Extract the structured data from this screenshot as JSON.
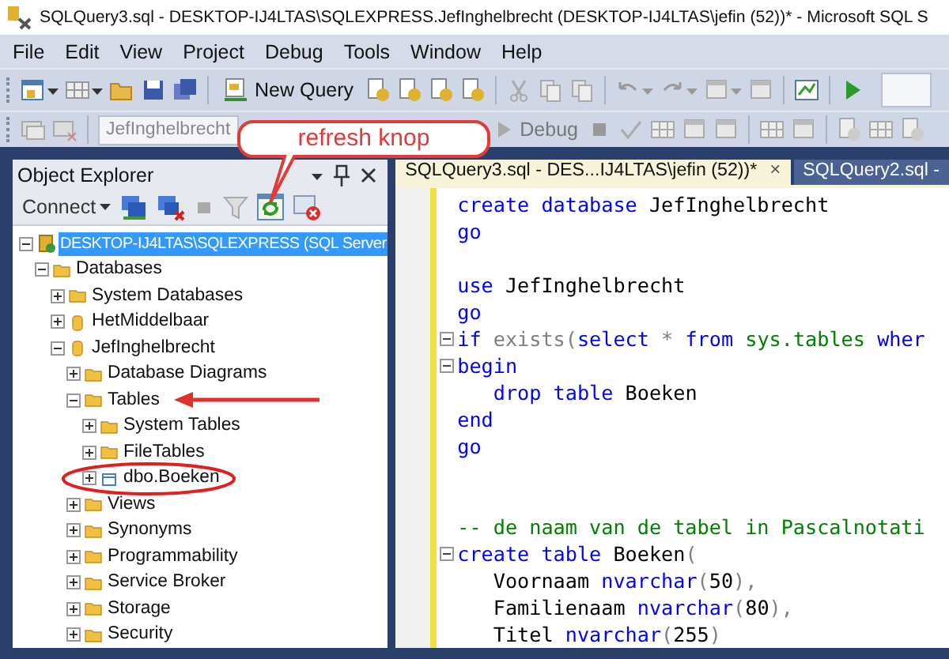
{
  "window": {
    "title": "SQLQuery3.sql - DESKTOP-IJ4LTAS\\SQLEXPRESS.JefInghelbrecht (DESKTOP-IJ4LTAS\\jefin (52))* - Microsoft SQL S"
  },
  "menu": [
    "File",
    "Edit",
    "View",
    "Project",
    "Debug",
    "Tools",
    "Window",
    "Help"
  ],
  "toolbar": {
    "new_query": "New Query",
    "database": "JefInghelbrecht",
    "debug": "Debug"
  },
  "callout": {
    "text": "refresh knop"
  },
  "object_explorer": {
    "title": "Object Explorer",
    "connect": "Connect",
    "tree": [
      {
        "label": "DESKTOP-IJ4LTAS\\SQLEXPRESS (SQL Server",
        "kind": "server",
        "expanded": true,
        "selected": true,
        "children": [
          {
            "label": "Databases",
            "kind": "folder",
            "expanded": true,
            "selected": false,
            "children": [
              {
                "label": "System Databases",
                "kind": "folder",
                "expanded": false,
                "selected": false
              },
              {
                "label": "HetMiddelbaar",
                "kind": "database",
                "expanded": false,
                "selected": false
              },
              {
                "label": "JefInghelbrecht",
                "kind": "database",
                "expanded": true,
                "selected": false,
                "children": [
                  {
                    "label": "Database Diagrams",
                    "kind": "folder",
                    "expanded": false,
                    "selected": false
                  },
                  {
                    "label": "Tables",
                    "kind": "folder",
                    "expanded": true,
                    "selected": false,
                    "pointed": true,
                    "children": [
                      {
                        "label": "System Tables",
                        "kind": "folder",
                        "expanded": false,
                        "selected": false
                      },
                      {
                        "label": "FileTables",
                        "kind": "folder",
                        "expanded": false,
                        "selected": false
                      },
                      {
                        "label": "dbo.Boeken",
                        "kind": "table",
                        "expanded": false,
                        "selected": false,
                        "circled": true
                      }
                    ]
                  },
                  {
                    "label": "Views",
                    "kind": "folder",
                    "expanded": false,
                    "selected": false
                  },
                  {
                    "label": "Synonyms",
                    "kind": "folder",
                    "expanded": false,
                    "selected": false
                  },
                  {
                    "label": "Programmability",
                    "kind": "folder",
                    "expanded": false,
                    "selected": false
                  },
                  {
                    "label": "Service Broker",
                    "kind": "folder",
                    "expanded": false,
                    "selected": false
                  },
                  {
                    "label": "Storage",
                    "kind": "folder",
                    "expanded": false,
                    "selected": false
                  },
                  {
                    "label": "Security",
                    "kind": "folder",
                    "expanded": false,
                    "selected": false
                  }
                ]
              }
            ]
          }
        ]
      }
    ]
  },
  "tabs": [
    {
      "label": "SQLQuery3.sql - DES...IJ4LTAS\\jefin (52))*",
      "selected": true,
      "close": "×"
    },
    {
      "label": "SQLQuery2.sql -",
      "selected": false
    }
  ],
  "editor": {
    "lines": [
      {
        "tokens": [
          {
            "text": "create database",
            "kind": "keyword"
          },
          {
            "text": " JefInghelbrecht",
            "kind": "identifier"
          }
        ]
      },
      {
        "tokens": [
          {
            "text": "go",
            "kind": "keyword"
          }
        ]
      },
      {
        "kind": "blank"
      },
      {
        "tokens": [
          {
            "text": "use",
            "kind": "keyword"
          },
          {
            "text": " JefInghelbrecht",
            "kind": "identifier"
          }
        ]
      },
      {
        "tokens": [
          {
            "text": "go",
            "kind": "keyword"
          }
        ]
      },
      {
        "fold": true,
        "tokens": [
          {
            "text": "if",
            "kind": "keyword"
          },
          {
            "text": " exists(",
            "kind": "function"
          },
          {
            "text": "select",
            "kind": "keyword"
          },
          {
            "text": " * ",
            "kind": "operator"
          },
          {
            "text": "from",
            "kind": "keyword"
          },
          {
            "text": " sys.tables ",
            "kind": "system"
          },
          {
            "text": "wher",
            "kind": "keyword"
          }
        ]
      },
      {
        "fold": true,
        "tokens": [
          {
            "text": "begin",
            "kind": "keyword"
          }
        ]
      },
      {
        "tokens": [
          {
            "text": "   drop table",
            "kind": "keyword"
          },
          {
            "text": " Boeken",
            "kind": "identifier"
          }
        ]
      },
      {
        "tokens": [
          {
            "text": "end",
            "kind": "keyword"
          }
        ]
      },
      {
        "tokens": [
          {
            "text": "go",
            "kind": "keyword"
          }
        ]
      },
      {
        "kind": "blank"
      },
      {
        "kind": "blank"
      },
      {
        "tokens": [
          {
            "text": "-- de naam van de tabel in Pascalnotati",
            "kind": "comment"
          }
        ]
      },
      {
        "fold": true,
        "tokens": [
          {
            "text": "create table",
            "kind": "keyword"
          },
          {
            "text": " Boeken",
            "kind": "identifier"
          },
          {
            "text": "(",
            "kind": "operator"
          }
        ]
      },
      {
        "tokens": [
          {
            "text": "   Voornaam",
            "kind": "identifier"
          },
          {
            "text": " nvarchar",
            "kind": "keyword"
          },
          {
            "text": "(",
            "kind": "operator"
          },
          {
            "text": "50",
            "kind": "identifier"
          },
          {
            "text": "),",
            "kind": "operator"
          }
        ]
      },
      {
        "tokens": [
          {
            "text": "   Familienaam",
            "kind": "identifier"
          },
          {
            "text": " nvarchar",
            "kind": "keyword"
          },
          {
            "text": "(",
            "kind": "operator"
          },
          {
            "text": "80",
            "kind": "identifier"
          },
          {
            "text": "),",
            "kind": "operator"
          }
        ]
      },
      {
        "tokens": [
          {
            "text": "   Titel",
            "kind": "identifier"
          },
          {
            "text": " nvarchar",
            "kind": "keyword"
          },
          {
            "text": "(",
            "kind": "operator"
          },
          {
            "text": "255",
            "kind": "identifier"
          },
          {
            "text": ")",
            "kind": "operator"
          }
        ]
      }
    ]
  }
}
